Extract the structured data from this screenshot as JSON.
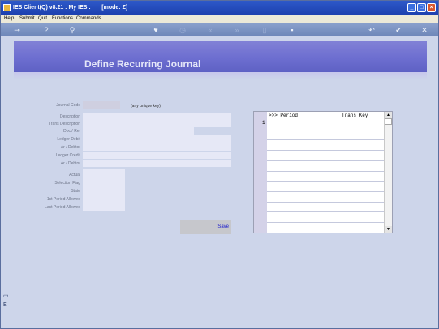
{
  "window": {
    "title": "IES Client(Q) v8.21 : My IES :       [mode: Z]",
    "buttons": [
      "minimize-icon",
      "maximize-icon",
      "close-icon"
    ],
    "colors": {
      "titlebar": "#1c3fae",
      "background": "#cdd5ea",
      "banner": "#6d6ed0"
    }
  },
  "menu": {
    "items": [
      "Help",
      "Submit",
      "Quit",
      "Functions",
      "Commands"
    ]
  },
  "toolbar": {
    "icons": [
      "key-icon",
      "help-icon",
      "search-icon",
      "heart-icon",
      "clock-icon",
      "rewind-icon",
      "fast-forward-icon",
      "bookmark-icon",
      "document-icon",
      "back-icon",
      "checkmark-icon",
      "close-icon"
    ],
    "glyphs": {
      "key": "⊸",
      "help": "?",
      "search": "⚲",
      "heart": "♥",
      "clock": "◷",
      "rewind": "«",
      "ffwd": "»",
      "bookmark": "▯",
      "document": "▪",
      "back": "↶",
      "check": "✔",
      "close": "✕"
    }
  },
  "page": {
    "title": "Define Recurring Journal"
  },
  "form": {
    "labels": {
      "journal_code": "Journal Code",
      "description": "Description",
      "trans_description": "Trans Description",
      "doc_ref": "Doc / Ref",
      "ledger_debit": "Ledger Debit",
      "ar_debtor_1": "Ar / Debtor",
      "ledger_credit": "Ledger Credit",
      "ar_debtor_2": "Ar / Debtor",
      "actual": "Actual",
      "selection_flag": "Selection Flag",
      "state": "State",
      "first_period": "1st Period Allowed",
      "last_period": "Last Period Allowed"
    },
    "values": {
      "journal_code": "",
      "description": "",
      "trans_description": "",
      "doc_ref": "",
      "ledger_debit": "",
      "ar_debtor_1": "",
      "ledger_credit": "",
      "ar_debtor_2": "",
      "actual": "",
      "selection_flag": "",
      "state": "",
      "first_period": "",
      "last_period": ""
    },
    "journal_code_hint": "(any unique key)",
    "save_label": "Save"
  },
  "grid": {
    "columns": [
      ">>> Period",
      "Trans Key"
    ],
    "row_marker": "1",
    "rows": [
      [
        "",
        ""
      ],
      [
        "",
        ""
      ],
      [
        "",
        ""
      ],
      [
        "",
        ""
      ],
      [
        "",
        ""
      ],
      [
        "",
        ""
      ],
      [
        "",
        ""
      ],
      [
        "",
        ""
      ],
      [
        "",
        ""
      ],
      [
        "",
        ""
      ],
      [
        "",
        ""
      ]
    ],
    "scroll_up": "▲",
    "scroll_down": "▼"
  },
  "side": {
    "icons": [
      "sidebar-app-icon",
      "sidebar-e-icon"
    ],
    "glyphs": [
      "▭",
      "E"
    ]
  }
}
